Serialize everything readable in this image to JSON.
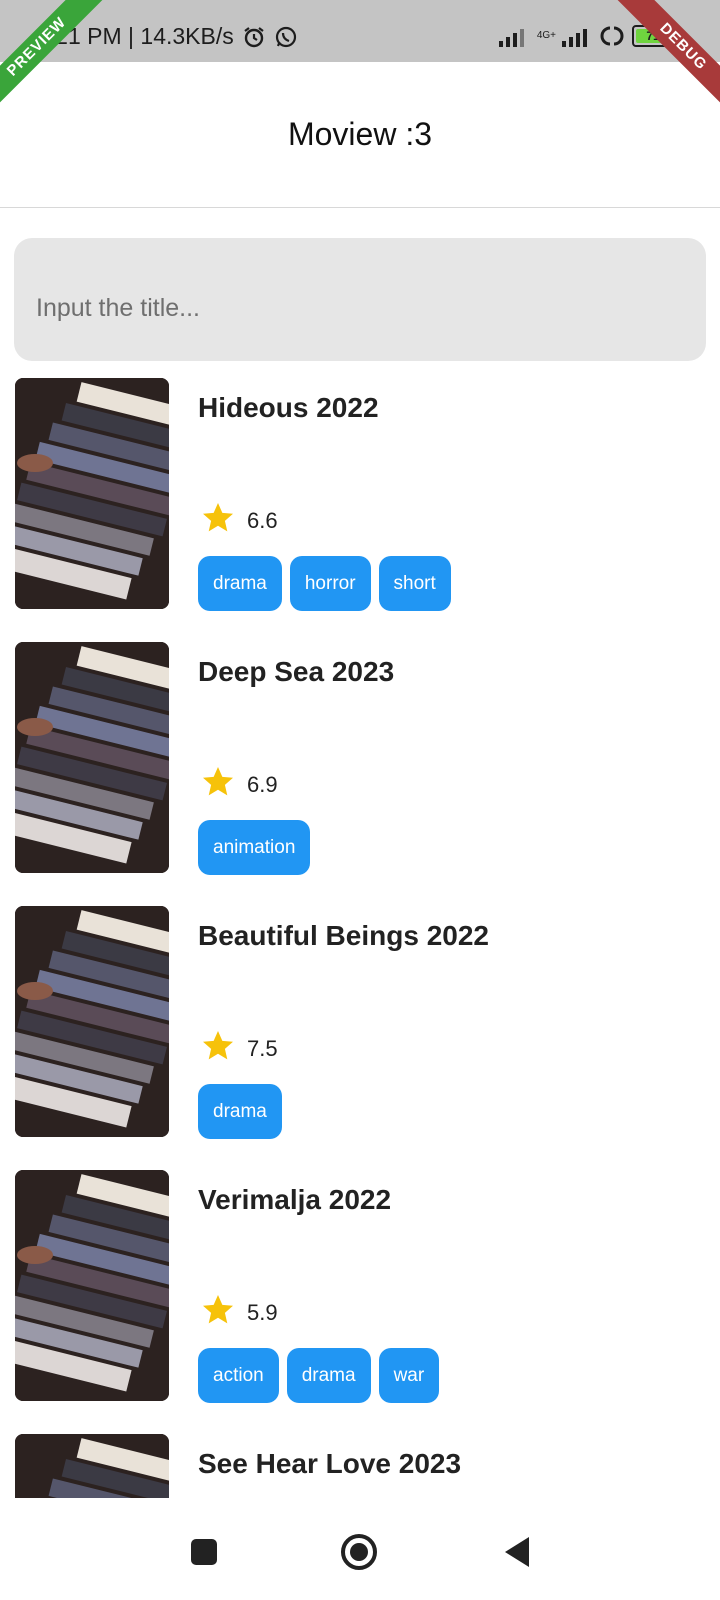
{
  "status_bar": {
    "time": "2:21 PM | 14.3KB/s",
    "network_label": "4G+",
    "battery": "71"
  },
  "ribbons": {
    "preview": "PREVIEW",
    "debug": "DEBUG"
  },
  "app_bar": {
    "title": "Moview :3"
  },
  "search": {
    "placeholder": "Input the title...",
    "value": ""
  },
  "colors": {
    "tag_bg": "#2196f3",
    "star": "#f6c20a",
    "search_bg": "#e6e6e6"
  },
  "movies": [
    {
      "title": "Hideous 2022",
      "rating": "6.6",
      "tags": [
        "drama",
        "horror",
        "short"
      ]
    },
    {
      "title": "Deep Sea 2023",
      "rating": "6.9",
      "tags": [
        "animation"
      ]
    },
    {
      "title": "Beautiful Beings 2022",
      "rating": "7.5",
      "tags": [
        "drama"
      ]
    },
    {
      "title": "Verimalja 2022",
      "rating": "5.9",
      "tags": [
        "action",
        "drama",
        "war"
      ]
    },
    {
      "title": "See Hear Love 2023",
      "rating": "",
      "tags": []
    }
  ],
  "nav": {
    "icons": [
      "recents-square-icon",
      "home-circle-icon",
      "back-triangle-icon"
    ]
  }
}
